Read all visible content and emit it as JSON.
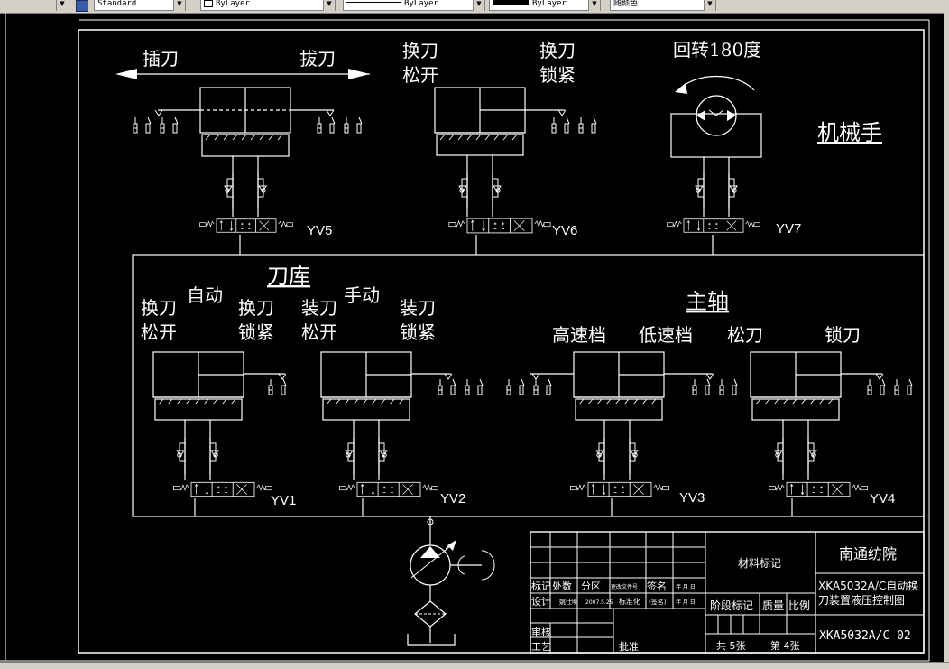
{
  "toolbar": {
    "text_style": "Standard",
    "layer": "ByLayer",
    "linetype": "ByLayer",
    "lineweight": "ByLayer",
    "color": "随颜色"
  },
  "labels": {
    "insert_tool": "插刀",
    "pull_tool": "拔刀",
    "tc_release": "换刀\n松开",
    "tc_clamp": "换刀\n锁紧",
    "rotate": "回转180度",
    "manipulator": "机械手",
    "magazine": "刀库",
    "auto": "自动",
    "manual": "手动",
    "mag_release": "换刀\n松开",
    "mag_clamp": "换刀\n锁紧",
    "load_release": "装刀\n松开",
    "load_clamp": "装刀\n锁紧",
    "spindle": "主轴",
    "high_speed": "高速档",
    "low_speed": "低速档",
    "loosen_tool": "松刀",
    "lock_tool": "锁刀"
  },
  "valves": [
    "YV1",
    "YV2",
    "YV3",
    "YV4",
    "YV5",
    "YV6",
    "YV7"
  ],
  "title_block": {
    "company": "南通纺院",
    "material": "材料标记",
    "title": "XKA5032A/C自动换\n刀装置液压控制图",
    "drawing_no": "XKA5032A/C-02",
    "stage_mark": "阶段标记",
    "weight": "质量",
    "scale": "比例",
    "sheets_total": "共 5张",
    "sheet_no": "第 4张",
    "mark": "标记",
    "count": "处数",
    "zone": "分区",
    "doc_no": "更改文件号",
    "sign": "签名",
    "date": "年 月 日",
    "design": "设计",
    "designer": "姚仕明",
    "design_date": "2007.5.25",
    "standardize": "标准化",
    "sign2": "(签名)",
    "date2": "年 月 日",
    "review": "审核",
    "process": "工艺",
    "approve": "批准"
  },
  "colors": {
    "background": "#000000",
    "line": "#ffffff",
    "toolbar": "#d4d0c8"
  }
}
